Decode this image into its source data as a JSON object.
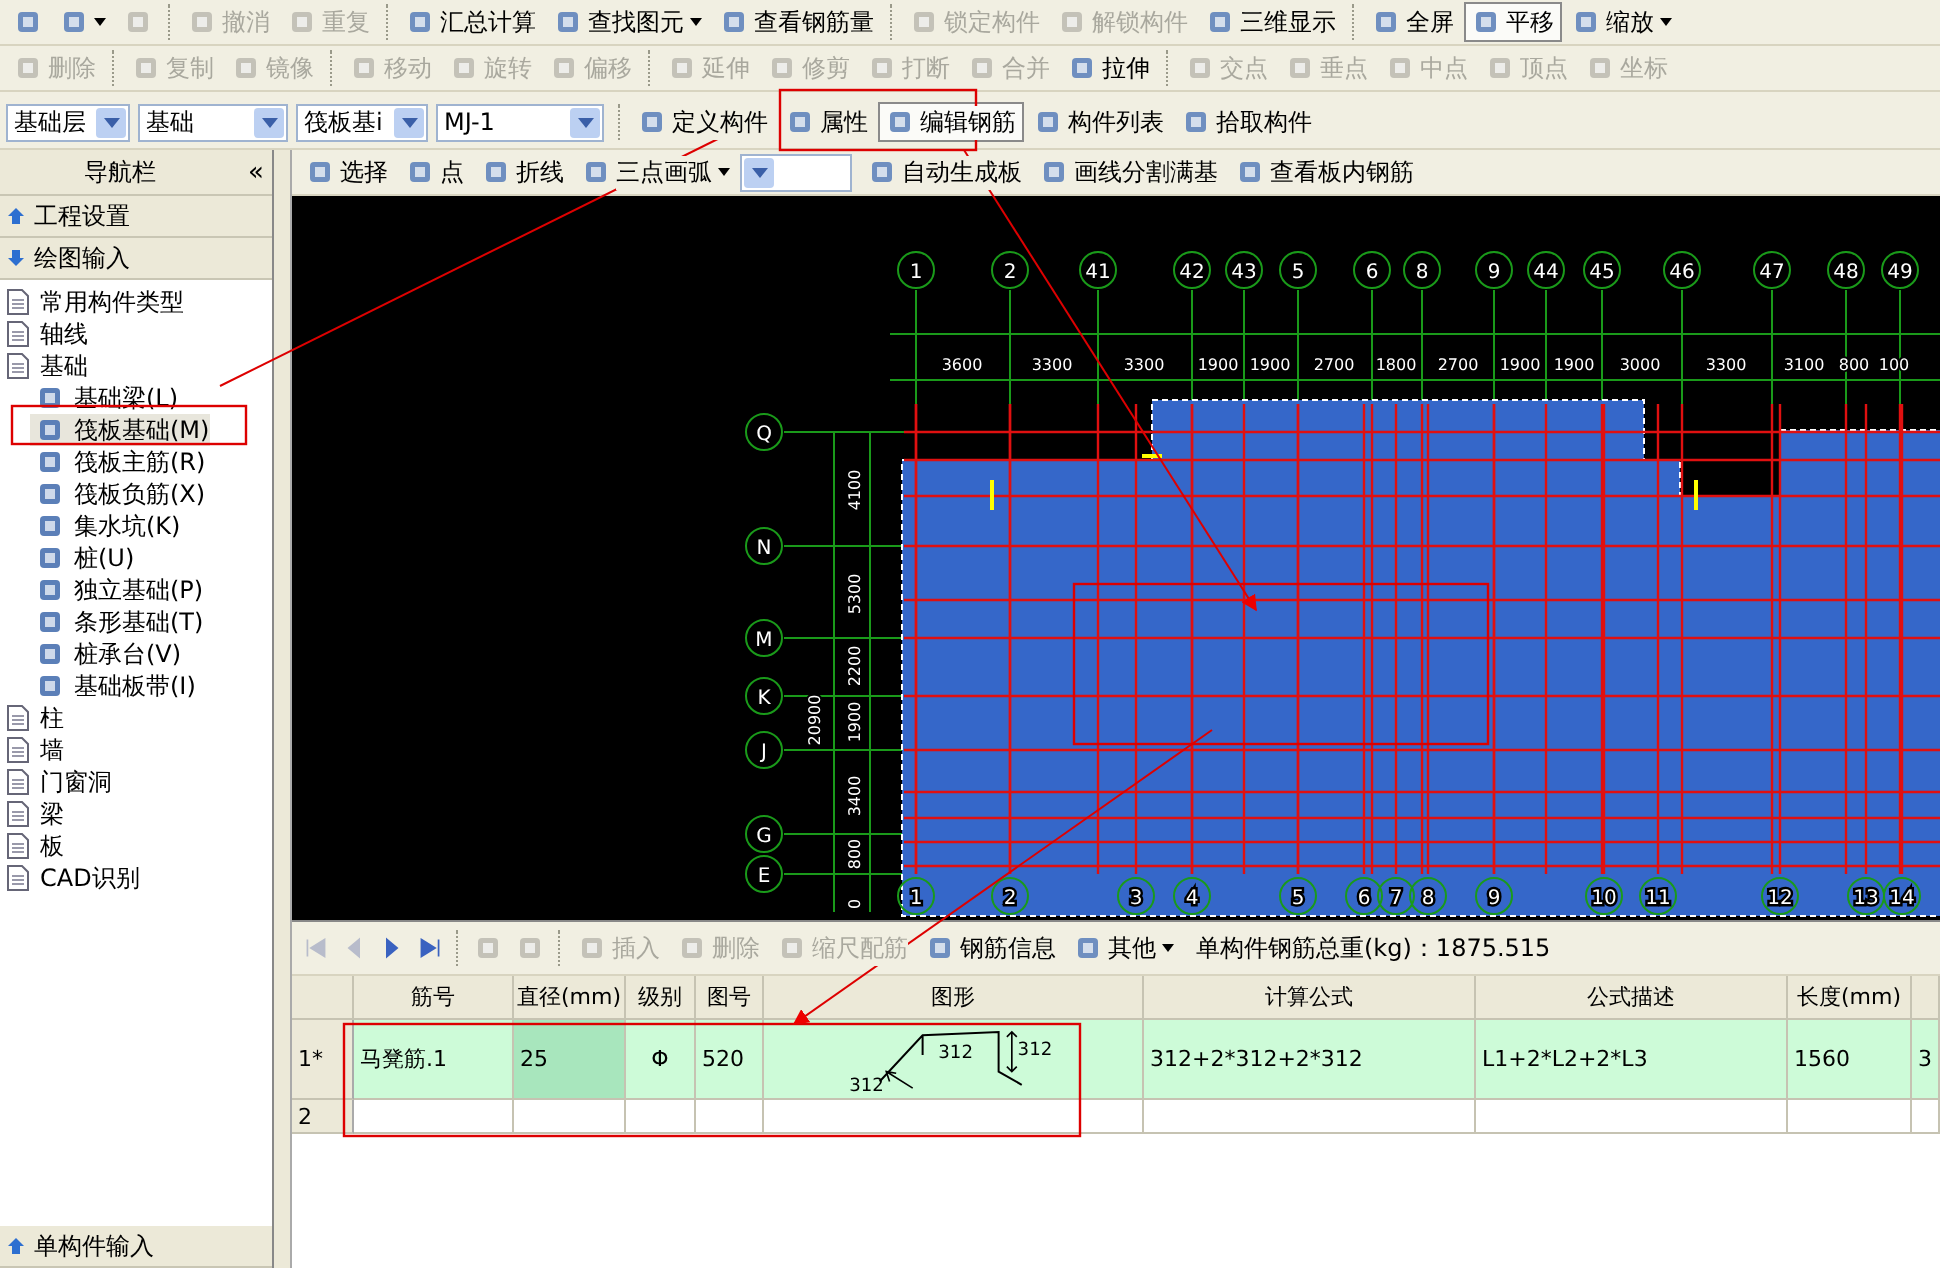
{
  "toolbar_1": [
    {
      "kind": "icon",
      "disabled": false,
      "pressed": false,
      "dropdown": false
    },
    {
      "kind": "icon",
      "disabled": false,
      "pressed": false,
      "dropdown": true
    },
    {
      "kind": "icon",
      "disabled": true,
      "pressed": false,
      "dropdown": false
    },
    {
      "kind": "separator"
    },
    {
      "kind": "button",
      "label": "撤消",
      "disabled": true,
      "pressed": false,
      "dropdown": false
    },
    {
      "kind": "button",
      "label": "重复",
      "disabled": true,
      "pressed": false,
      "dropdown": false
    },
    {
      "kind": "separator"
    },
    {
      "kind": "button",
      "label": "汇总计算",
      "disabled": false,
      "pressed": false,
      "dropdown": false
    },
    {
      "kind": "button",
      "label": "查找图元",
      "disabled": false,
      "pressed": false,
      "dropdown": true
    },
    {
      "kind": "button",
      "label": "查看钢筋量",
      "disabled": false,
      "pressed": false,
      "dropdown": false
    },
    {
      "kind": "separator"
    },
    {
      "kind": "button",
      "label": "锁定构件",
      "disabled": true,
      "pressed": false,
      "dropdown": false
    },
    {
      "kind": "button",
      "label": "解锁构件",
      "disabled": true,
      "pressed": false,
      "dropdown": false
    },
    {
      "kind": "button",
      "label": "三维显示",
      "disabled": false,
      "pressed": false,
      "dropdown": false
    },
    {
      "kind": "separator"
    },
    {
      "kind": "button",
      "label": "全屏",
      "disabled": false,
      "pressed": false,
      "dropdown": false
    },
    {
      "kind": "button",
      "label": "平移",
      "disabled": false,
      "pressed": true,
      "dropdown": false
    },
    {
      "kind": "button",
      "label": "缩放",
      "disabled": false,
      "pressed": false,
      "dropdown": true
    }
  ],
  "toolbar_2": [
    {
      "kind": "button",
      "label": "删除",
      "disabled": true
    },
    {
      "kind": "separator"
    },
    {
      "kind": "button",
      "label": "复制",
      "disabled": true
    },
    {
      "kind": "button",
      "label": "镜像",
      "disabled": true
    },
    {
      "kind": "separator"
    },
    {
      "kind": "button",
      "label": "移动",
      "disabled": true
    },
    {
      "kind": "button",
      "label": "旋转",
      "disabled": true
    },
    {
      "kind": "button",
      "label": "偏移",
      "disabled": true
    },
    {
      "kind": "separator"
    },
    {
      "kind": "button",
      "label": "延伸",
      "disabled": true
    },
    {
      "kind": "button",
      "label": "修剪",
      "disabled": true
    },
    {
      "kind": "button",
      "label": "打断",
      "disabled": true
    },
    {
      "kind": "button",
      "label": "合并",
      "disabled": true
    },
    {
      "kind": "button",
      "label": "拉伸",
      "disabled": false
    },
    {
      "kind": "separator"
    },
    {
      "kind": "button",
      "label": "交点",
      "disabled": true
    },
    {
      "kind": "button",
      "label": "垂点",
      "disabled": true
    },
    {
      "kind": "button",
      "label": "中点",
      "disabled": true
    },
    {
      "kind": "button",
      "label": "顶点",
      "disabled": true
    },
    {
      "kind": "button",
      "label": "坐标",
      "disabled": true
    }
  ],
  "toolbar_3": {
    "selects": [
      {
        "value": "基础层"
      },
      {
        "value": "基础"
      },
      {
        "value": "筏板基i"
      },
      {
        "value": "MJ-1"
      }
    ],
    "buttons": [
      {
        "label": "定义构件",
        "pressed": false
      },
      {
        "label": "属性",
        "pressed": false
      },
      {
        "label": "编辑钢筋",
        "pressed": true
      },
      {
        "label": "构件列表",
        "pressed": false
      },
      {
        "label": "拾取构件",
        "pressed": false
      }
    ]
  },
  "navigator": {
    "title": "导航栏",
    "collapse": "«",
    "sections": [
      {
        "label": "工程设置",
        "expanded": false
      },
      {
        "label": "绘图输入",
        "expanded": true
      }
    ],
    "tree": [
      {
        "label": "常用构件类型",
        "selected": false
      },
      {
        "label": "轴线",
        "selected": false
      },
      {
        "label": "基础",
        "selected": false,
        "children": [
          {
            "label": "基础梁(L)",
            "selected": false
          },
          {
            "label": "筏板基础(M)",
            "selected": true
          },
          {
            "label": "筏板主筋(R)",
            "selected": false
          },
          {
            "label": "筏板负筋(X)",
            "selected": false
          },
          {
            "label": "集水坑(K)",
            "selected": false
          },
          {
            "label": "桩(U)",
            "selected": false
          },
          {
            "label": "独立基础(P)",
            "selected": false
          },
          {
            "label": "条形基础(T)",
            "selected": false
          },
          {
            "label": "桩承台(V)",
            "selected": false
          },
          {
            "label": "基础板带(I)",
            "selected": false
          }
        ]
      },
      {
        "label": "柱",
        "selected": false
      },
      {
        "label": "墙",
        "selected": false
      },
      {
        "label": "门窗洞",
        "selected": false
      },
      {
        "label": "梁",
        "selected": false
      },
      {
        "label": "板",
        "selected": false
      },
      {
        "label": "CAD识别",
        "selected": false
      }
    ],
    "bottom_section": {
      "label": "单构件输入",
      "expanded": false
    }
  },
  "draw_toolbar": [
    {
      "kind": "button",
      "label": "选择",
      "dropdown": false
    },
    {
      "kind": "button",
      "label": "点",
      "dropdown": false
    },
    {
      "kind": "button",
      "label": "折线",
      "dropdown": false
    },
    {
      "kind": "button",
      "label": "三点画弧",
      "dropdown": true
    },
    {
      "kind": "combo"
    },
    {
      "kind": "button",
      "label": "自动生成板",
      "dropdown": false
    },
    {
      "kind": "button",
      "label": "画线分割满基",
      "dropdown": false
    },
    {
      "kind": "button",
      "label": "查看板内钢筋",
      "dropdown": false
    }
  ],
  "drawing": {
    "top_axis_labels": [
      "1",
      "2",
      "41",
      "42",
      "43",
      "5",
      "6",
      "8",
      "9",
      "44",
      "45",
      "46",
      "47",
      "48",
      "49"
    ],
    "top_dimensions": [
      "3600",
      "3300",
      "3300",
      "1900",
      "1900",
      "2700",
      "1800",
      "2700",
      "1900",
      "1900",
      "3000",
      "3300",
      "3100",
      "800",
      "100"
    ],
    "left_axis_labels": [
      "Q",
      "N",
      "M",
      "K",
      "J",
      "G",
      "E"
    ],
    "left_dimensions": [
      "4100",
      "5300",
      "2200",
      "1900",
      "3400",
      "800",
      "0"
    ],
    "overall_dimension": "20900",
    "bottom_axis_labels": [
      "1",
      "2",
      "3",
      "4",
      "5",
      "6",
      "7",
      "8",
      "9",
      "10",
      "11",
      "12",
      "13",
      "14"
    ]
  },
  "rebar_toolbar": {
    "buttons": [
      {
        "label": "插入",
        "disabled": true,
        "dropdown": false
      },
      {
        "label": "删除",
        "disabled": true,
        "dropdown": false
      },
      {
        "label": "缩尺配筋",
        "disabled": true,
        "dropdown": false
      },
      {
        "label": "钢筋信息",
        "disabled": false,
        "dropdown": false
      },
      {
        "label": "其他",
        "disabled": false,
        "dropdown": true
      }
    ],
    "total_weight": "单构件钢筋总重(kg)：1875.515"
  },
  "table": {
    "columns": [
      "筋号",
      "直径(mm)",
      "级别",
      "图号",
      "图形",
      "计算公式",
      "公式描述",
      "长度(mm)"
    ],
    "rows": [
      {
        "index": "1*",
        "selected": true,
        "cells": [
          {
            "kind": "text",
            "text": "马凳筋.1",
            "focused": false
          },
          {
            "kind": "text",
            "text": "25",
            "focused": true
          },
          {
            "kind": "text",
            "text": "Φ",
            "focused": false
          },
          {
            "kind": "text",
            "text": "520",
            "focused": false
          },
          {
            "kind": "shape",
            "labels": [
              "312",
              "312",
              "312"
            ],
            "focused": false
          },
          {
            "kind": "text",
            "text": "312+2*312+2*312",
            "focused": false
          },
          {
            "kind": "text",
            "text": "L1+2*L2+2*L3",
            "focused": false
          },
          {
            "kind": "text",
            "text": "1560",
            "focused": false
          },
          {
            "kind": "text",
            "text": "3",
            "focused": false
          }
        ]
      },
      {
        "index": "2",
        "selected": false,
        "cells": []
      }
    ]
  }
}
